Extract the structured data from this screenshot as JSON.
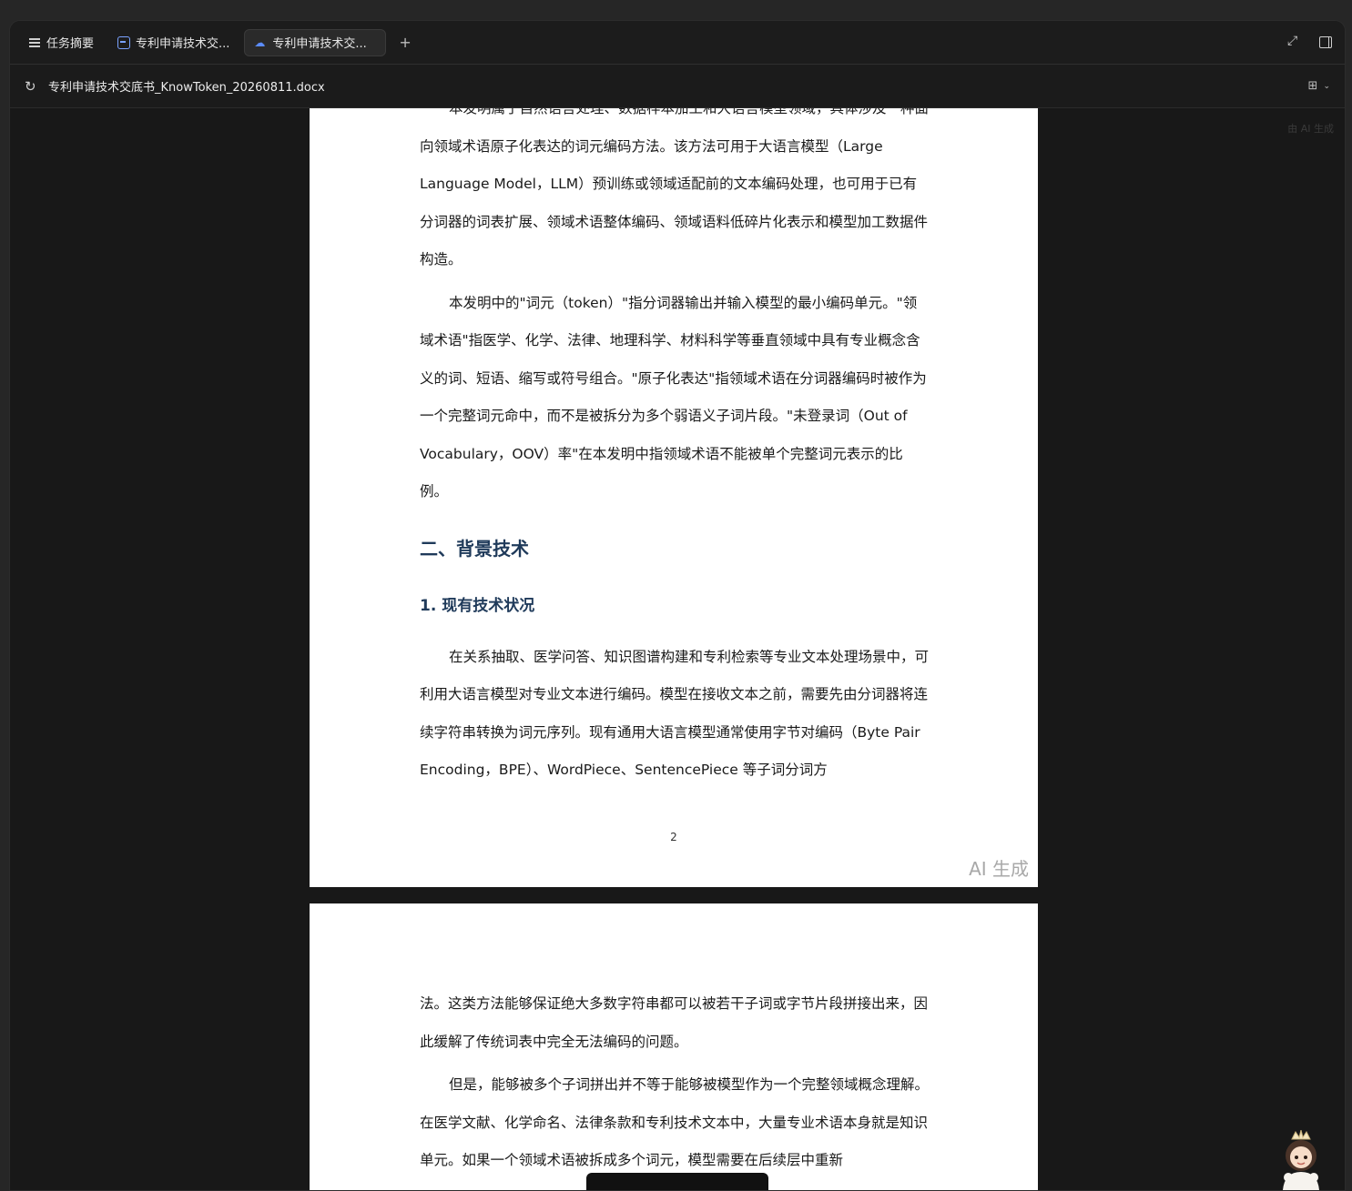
{
  "tabs": {
    "summary": "任务摘要",
    "doc1": "专利申请技术交...",
    "doc2": "专利申请技术交..."
  },
  "addressbar": {
    "filename": "专利申请技术交底书_KnowToken_20260811.docx"
  },
  "viewer": {
    "watermark_small": "由 AI 生成"
  },
  "page1": {
    "para0": "本发明属于自然语言处理、数据样本加工和大语言模型领域，具体涉及一种面向领域术语原子化表达的词元编码方法。该方法可用于大语言模型（Large Language Model，LLM）预训练或领域适配前的文本编码处理，也可用于已有分词器的词表扩展、领域术语整体编码、领域语料低碎片化表示和模型加工数据件构造。",
    "para1": "本发明中的\"词元（token）\"指分词器输出并输入模型的最小编码单元。\"领域术语\"指医学、化学、法律、地理科学、材料科学等垂直领域中具有专业概念含义的词、短语、缩写或符号组合。\"原子化表达\"指领域术语在分词器编码时被作为一个完整词元命中，而不是被拆分为多个弱语义子词片段。\"未登录词（Out of Vocabulary，OOV）率\"在本发明中指领域术语不能被单个完整词元表示的比例。",
    "heading1": "二、背景技术",
    "heading2": "1. 现有技术状况",
    "para2": "在关系抽取、医学问答、知识图谱构建和专利检索等专业文本处理场景中，可利用大语言模型对专业文本进行编码。模型在接收文本之前，需要先由分词器将连续字符串转换为词元序列。现有通用大语言模型通常使用字节对编码（Byte Pair Encoding，BPE）、WordPiece、SentencePiece 等子词分词方",
    "page_number": "2",
    "ai_label": "AI 生成"
  },
  "page2": {
    "para0": "法。这类方法能够保证绝大多数字符串都可以被若干子词或字节片段拼接出来，因此缓解了传统词表中完全无法编码的问题。",
    "para1": "但是，能够被多个子词拼出并不等于能够被模型作为一个完整领域概念理解。在医学文献、化学命名、法律条款和专利技术文本中，大量专业术语本身就是知识单元。如果一个领域术语被拆成多个词元，模型需要在后续层中重新"
  }
}
